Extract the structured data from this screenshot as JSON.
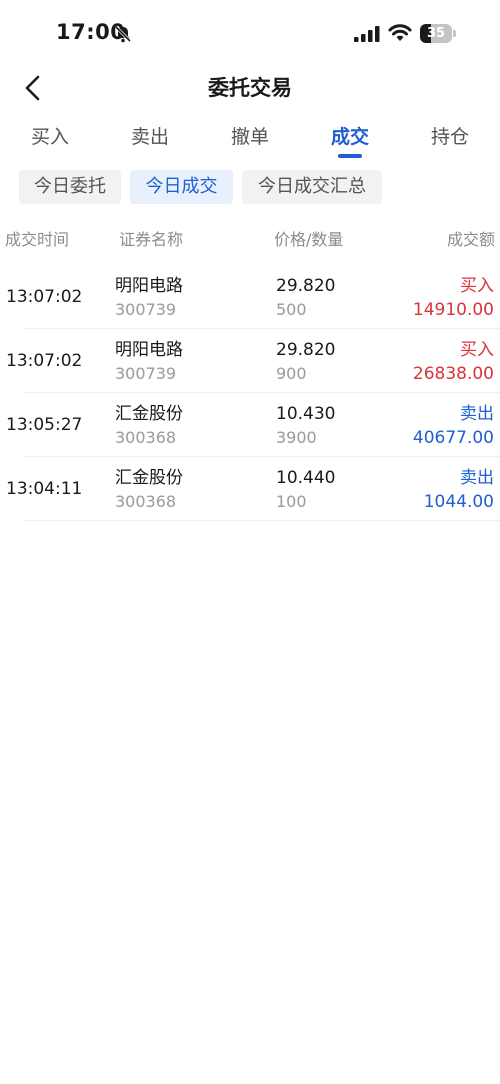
{
  "status_bar": {
    "time": "17:00",
    "battery_level": "35",
    "battery_fraction": 0.35
  },
  "nav": {
    "title": "委托交易"
  },
  "tabs": [
    {
      "label": "买入"
    },
    {
      "label": "卖出"
    },
    {
      "label": "撤单"
    },
    {
      "label": "成交",
      "active": true
    },
    {
      "label": "持仓"
    }
  ],
  "chips": [
    {
      "label": "今日委托"
    },
    {
      "label": "今日成交",
      "active": true
    },
    {
      "label": "今日成交汇总"
    }
  ],
  "table": {
    "headers": [
      "成交时间",
      "证券名称",
      "价格/数量",
      "成交额"
    ],
    "rows": [
      {
        "time": "13:07:02",
        "name": "明阳电路",
        "code": "300739",
        "price": "29.820",
        "quantity": "500",
        "direction": "买入",
        "amount": "14910.00"
      },
      {
        "time": "13:07:02",
        "name": "明阳电路",
        "code": "300739",
        "price": "29.820",
        "quantity": "900",
        "direction": "买入",
        "amount": "26838.00"
      },
      {
        "time": "13:05:27",
        "name": "汇金股份",
        "code": "300368",
        "price": "10.430",
        "quantity": "3900",
        "direction": "卖出",
        "amount": "40677.00"
      },
      {
        "time": "13:04:11",
        "name": "汇金股份",
        "code": "300368",
        "price": "10.440",
        "quantity": "100",
        "direction": "卖出",
        "amount": "1044.00"
      }
    ]
  },
  "colors": {
    "accent": "#1f5fd0",
    "buy": "#d9343b",
    "sell": "#1f5fd0"
  }
}
